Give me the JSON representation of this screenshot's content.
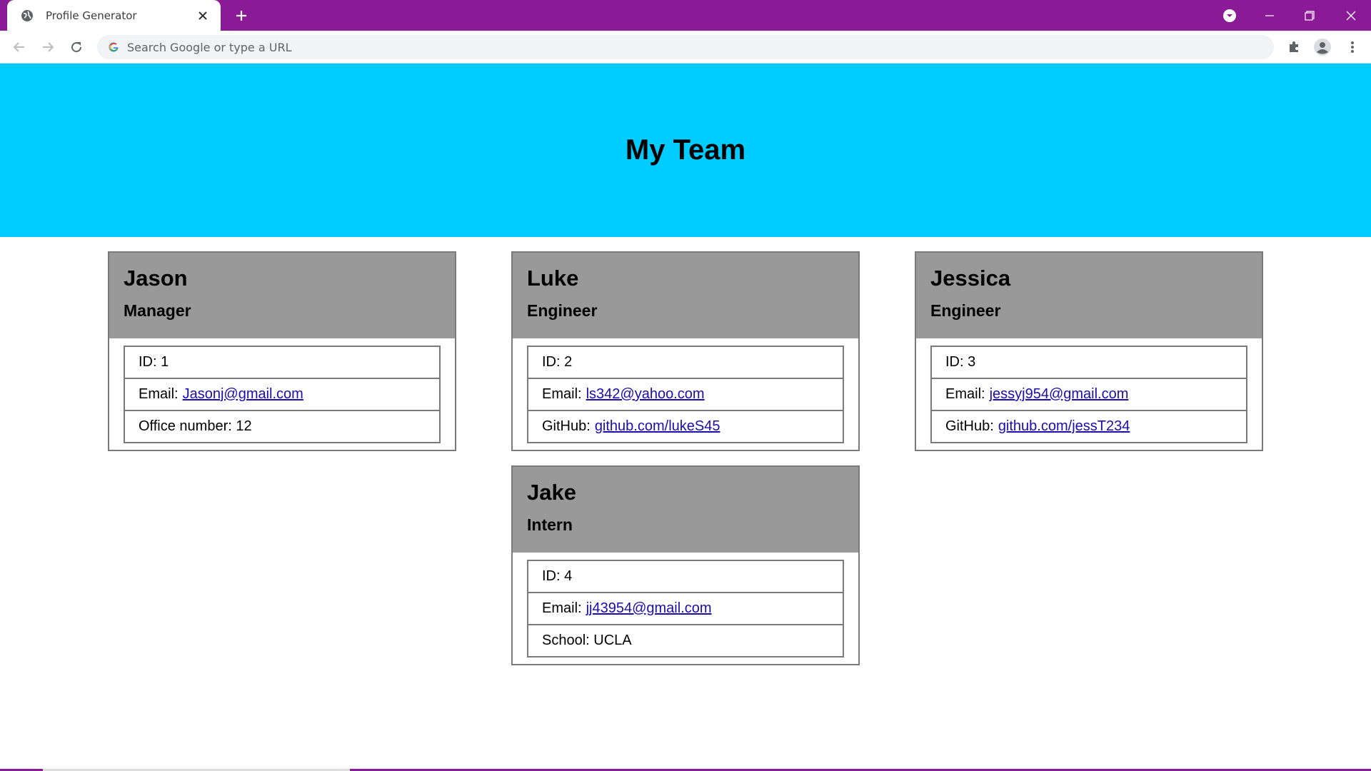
{
  "browser": {
    "tab_title": "Profile Generator",
    "omnibox_placeholder": "Search Google or type a URL"
  },
  "page": {
    "heading": "My Team"
  },
  "team": [
    {
      "name": "Jason",
      "role": "Manager",
      "id_label": "ID: 1",
      "email_prefix": "Email:",
      "email": "Jasonj@gmail.com",
      "third_prefix": "Office number: 12",
      "third_link": ""
    },
    {
      "name": "Luke",
      "role": "Engineer",
      "id_label": "ID: 2",
      "email_prefix": "Email:",
      "email": "ls342@yahoo.com",
      "third_prefix": "GitHub:",
      "third_link": "github.com/lukeS45"
    },
    {
      "name": "Jessica",
      "role": "Engineer",
      "id_label": "ID: 3",
      "email_prefix": "Email:",
      "email": "jessyj954@gmail.com",
      "third_prefix": "GitHub:",
      "third_link": "github.com/jessT234"
    },
    {
      "name": "Jake",
      "role": "Intern",
      "id_label": "ID: 4",
      "email_prefix": "Email:",
      "email": "jj43954@gmail.com",
      "third_prefix": "School: UCLA",
      "third_link": ""
    }
  ],
  "colors": {
    "tabstrip": "#8a1a96",
    "hero": "#00ccff",
    "card_header": "#999999",
    "link": "#1a0dab"
  },
  "icons": {
    "favicon": "globe-icon",
    "close": "close-icon",
    "new_tab": "plus-icon",
    "back": "back-arrow-icon",
    "forward": "forward-arrow-icon",
    "reload": "reload-icon",
    "extensions": "puzzle-icon",
    "profile": "profile-icon",
    "menu": "kebab-menu-icon"
  }
}
